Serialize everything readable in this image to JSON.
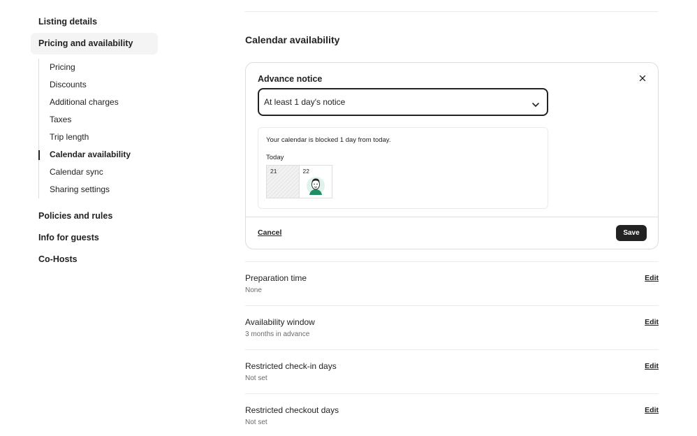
{
  "sidebar": {
    "listing_details": "Listing details",
    "pricing_availability": "Pricing and availability",
    "subitems": [
      {
        "label": "Pricing"
      },
      {
        "label": "Discounts"
      },
      {
        "label": "Additional charges"
      },
      {
        "label": "Taxes"
      },
      {
        "label": "Trip length"
      },
      {
        "label": "Calendar availability"
      },
      {
        "label": "Calendar sync"
      },
      {
        "label": "Sharing settings"
      }
    ],
    "policies": "Policies and rules",
    "info_guests": "Info for guests",
    "cohosts": "Co-Hosts"
  },
  "main": {
    "section_title": "Calendar availability",
    "advance_notice": {
      "title": "Advance notice",
      "select_value": "At least 1 day's notice",
      "info_text": "Your calendar is blocked 1 day from today.",
      "today_label": "Today",
      "day1": "21",
      "day2": "22",
      "cancel": "Cancel",
      "save": "Save"
    },
    "rows": [
      {
        "title": "Preparation time",
        "subtitle": "None",
        "edit": "Edit"
      },
      {
        "title": "Availability window",
        "subtitle": "3 months in advance",
        "edit": "Edit"
      },
      {
        "title": "Restricted check-in days",
        "subtitle": "Not set",
        "edit": "Edit"
      },
      {
        "title": "Restricted checkout days",
        "subtitle": "Not set",
        "edit": "Edit"
      }
    ]
  },
  "icons": {
    "close": "close-icon",
    "chevron": "chevron-down-icon",
    "avatar": "avatar-illustration"
  }
}
